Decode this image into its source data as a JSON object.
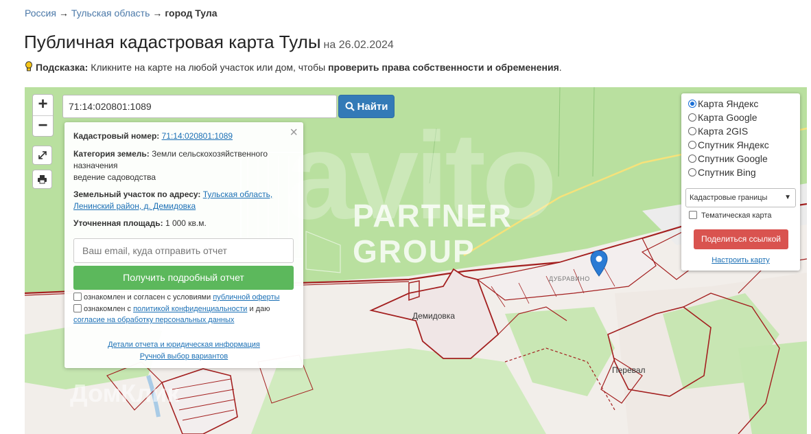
{
  "breadcrumb": {
    "items": [
      "Россия",
      "Тульская область"
    ],
    "separator": "→",
    "current": "город Тула"
  },
  "page": {
    "title": "Публичная кадастровая карта Тулы",
    "date": "на 26.02.2024"
  },
  "hint": {
    "label": "Подсказка:",
    "text": "Кликните на карте на любой участок или дом, чтобы",
    "bold": "проверить права собственности и обременения",
    "end": "."
  },
  "map": {
    "zoom_in": "+",
    "zoom_out": "−",
    "search": {
      "value": "71:14:020801:1089",
      "button_label": "Найти"
    },
    "places": {
      "demidovka": "Демидовка",
      "dubravino": "ДУБРАВИНО",
      "pereval": "Перевал"
    },
    "watermarks": {
      "partner1": "PARTNER",
      "partner2": "GROUP",
      "avito": "avito",
      "domclick": "ДомКлик"
    },
    "colors": {
      "accent_blue": "#337ab7",
      "success_green": "#5cb85c",
      "danger_red": "#d9534f",
      "parcel_border": "#a31f1f",
      "map_green": "#b8e0a0"
    }
  },
  "popup": {
    "close": "×",
    "cadastral_label": "Кадастровый номер:",
    "cadastral_value": "71:14:020801:1089",
    "category_label": "Категория земель:",
    "category_value": "Земли сельскохозяйственного назначения",
    "usage": "ведение садоводства",
    "address_label": "Земельный участок по адресу:",
    "address_line1": "Тульская область,",
    "address_line2": "Ленинский район, д. Демидовка",
    "area_label": "Уточненная площадь:",
    "area_value": "1 000 кв.м.",
    "email_placeholder": "Ваш email, куда отправить отчет",
    "report_button": "Получить подробный отчет",
    "agree1_text": "ознакомлен и согласен с условиями",
    "agree1_link": "публичной оферты",
    "agree2_text": "ознакомлен с",
    "agree2_link": "политикой конфиденциальности",
    "agree2_and": "и даю",
    "agree2_link2": "согласие на обработку персональных данных",
    "details_link": "Детали отчета и юридическая информация",
    "manual_link": "Ручной выбор вариантов"
  },
  "layers": {
    "options": [
      {
        "label": "Карта Яндекс",
        "selected": true
      },
      {
        "label": "Карта Google",
        "selected": false
      },
      {
        "label": "Карта 2GIS",
        "selected": false
      },
      {
        "label": "Спутник Яндекс",
        "selected": false
      },
      {
        "label": "Спутник Google",
        "selected": false
      },
      {
        "label": "Спутник Bing",
        "selected": false
      }
    ],
    "select_value": "Кадастровые границы",
    "thematic_label": "Тематическая карта",
    "share_button": "Поделиться ссылкой",
    "configure_link": "Настроить карту"
  }
}
